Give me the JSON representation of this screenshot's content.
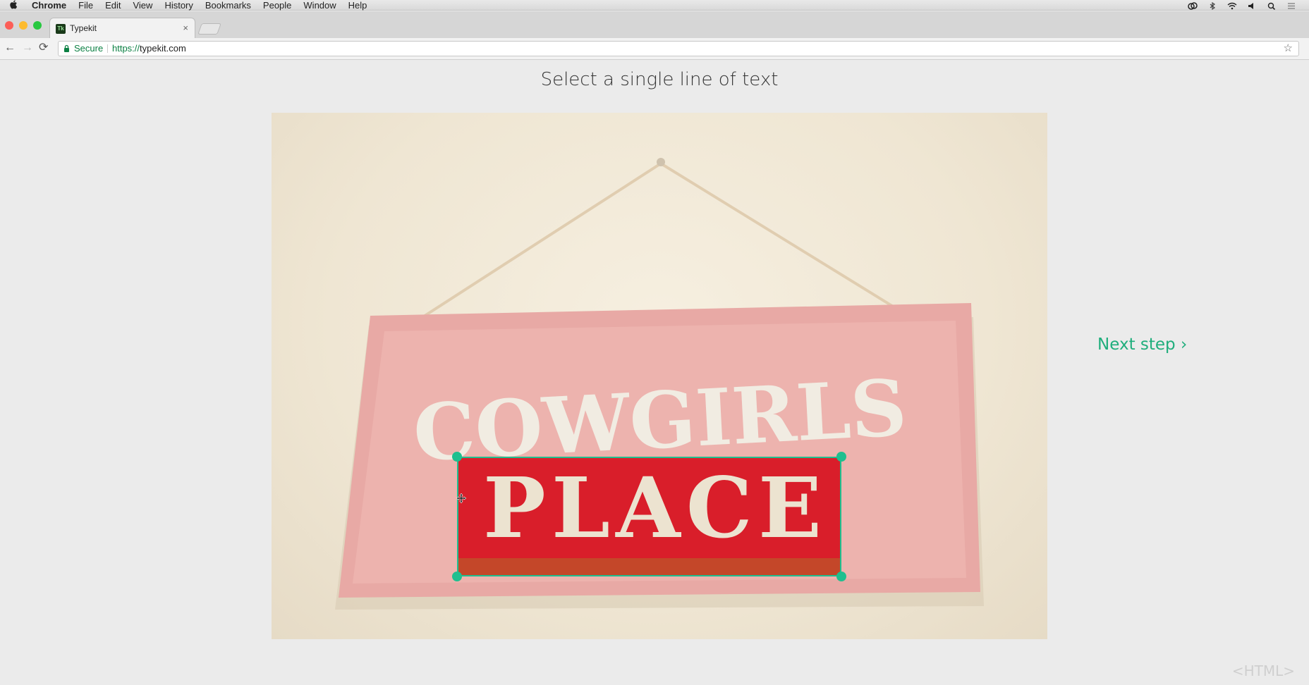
{
  "menubar": {
    "apple": "",
    "items": [
      "Chrome",
      "File",
      "Edit",
      "View",
      "History",
      "Bookmarks",
      "People",
      "Window",
      "Help"
    ],
    "status_icons": [
      "creative-cloud-icon",
      "bluetooth-icon",
      "wifi-icon",
      "volume-icon",
      "spotlight-search-icon",
      "notification-center-icon"
    ]
  },
  "tab": {
    "favicon": "Tk",
    "title": "Typekit",
    "close": "×"
  },
  "toolbar": {
    "back": "←",
    "forward": "→",
    "reload": "⟳",
    "secure_label": "Secure",
    "url_scheme": "https://",
    "url_host": "typekit.com",
    "bookmark_star": "☆"
  },
  "page": {
    "heading": "Select a single line of text",
    "next_step": "Next step ›",
    "sign_line_1": "COWGIRLS",
    "sign_line_2": "PLACE",
    "accent_color": "#1fbf8f"
  },
  "watermark": "<HTML>"
}
